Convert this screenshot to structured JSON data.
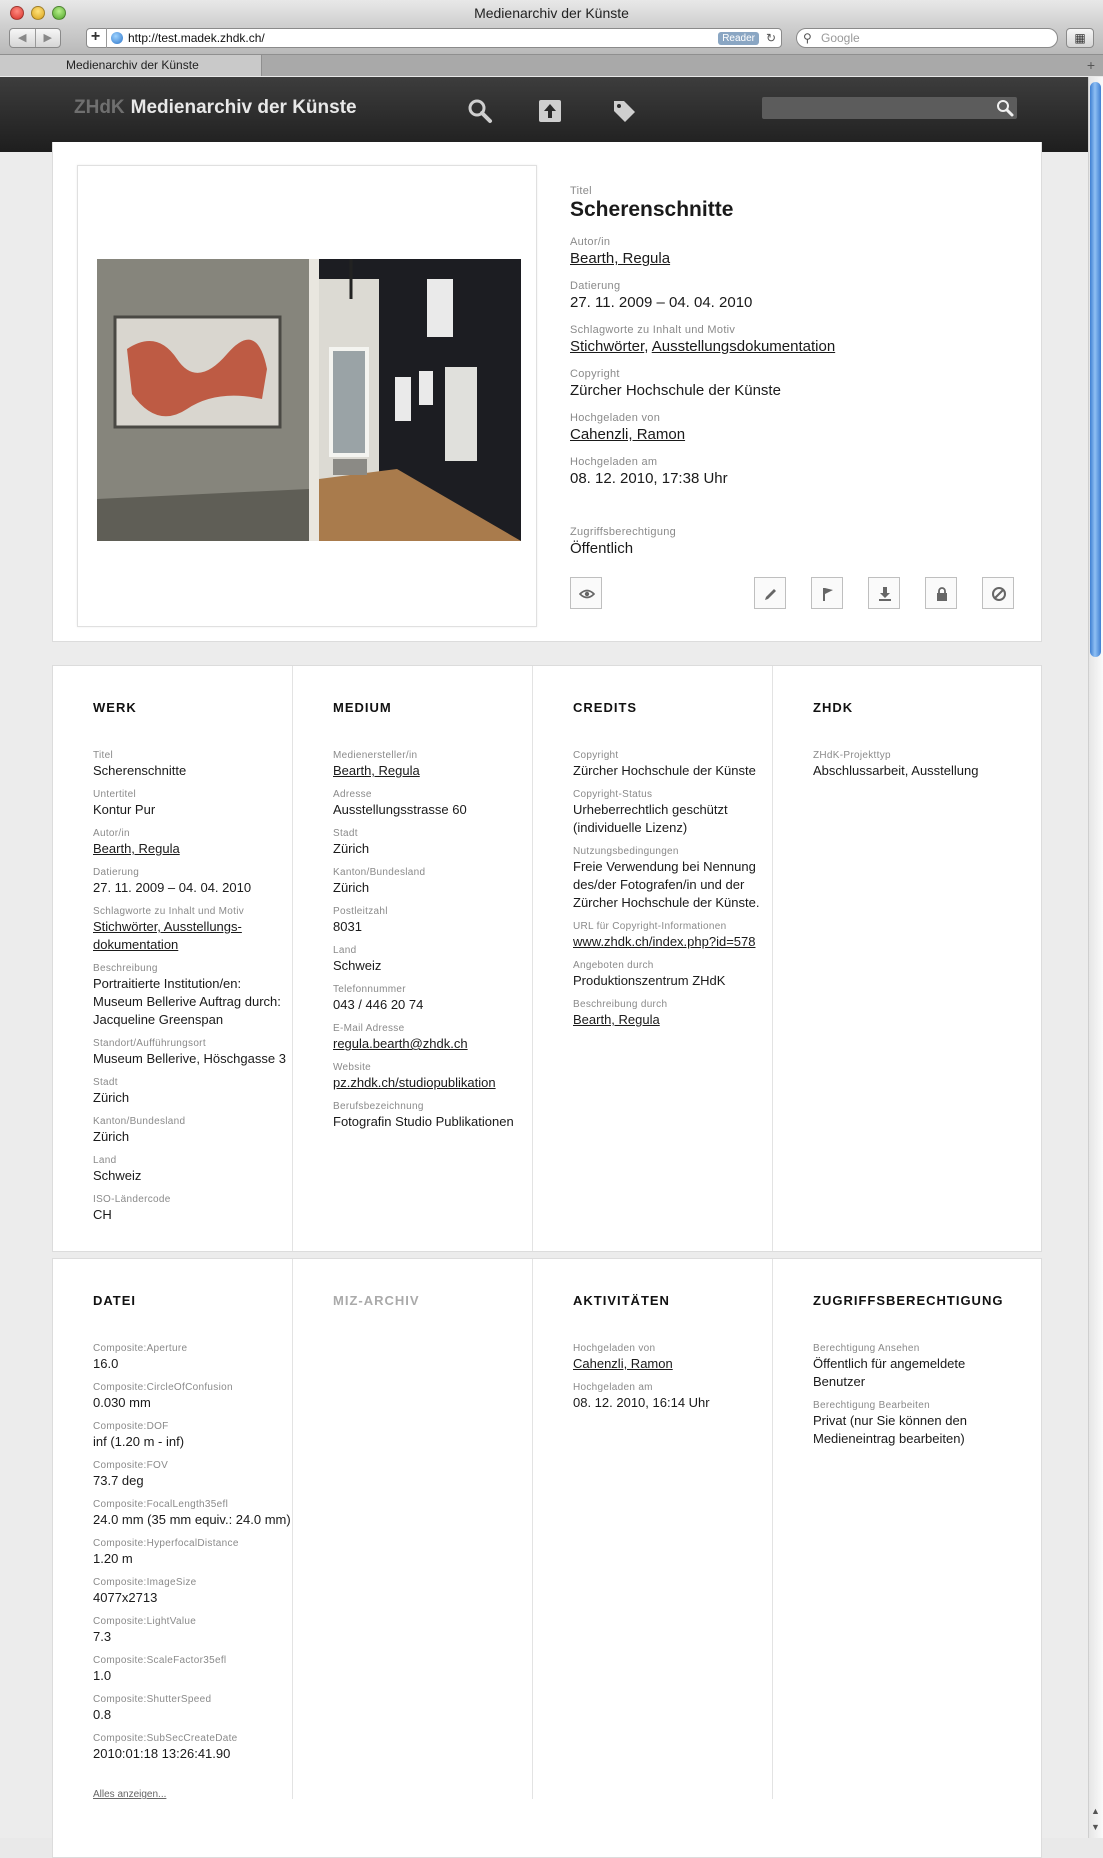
{
  "window": {
    "title": "Medienarchiv der Künste"
  },
  "browser": {
    "url": "http://test.madek.zhdk.ch/",
    "reader_label": "Reader",
    "search_placeholder": "Google",
    "tab_title": "Medienarchiv der Künste"
  },
  "header": {
    "brand_short": "ZHdK",
    "brand_name": "Medienarchiv der Künste",
    "icons": [
      "search-icon",
      "upload-icon",
      "tag-icon"
    ],
    "search_value": ""
  },
  "entry": {
    "title_label": "Titel",
    "title": "Scherenschnitte",
    "author_label": "Autor/in",
    "author": "Bearth, Regula",
    "date_label": "Datierung",
    "date": "27. 11. 2009 – 04. 04. 2010",
    "keywords_label": "Schlagworte zu Inhalt und Motiv",
    "keyword1": "Stichwörter",
    "keyword_sep": ", ",
    "keyword2": "Ausstellungsdokumentation",
    "copyright_label": "Copyright",
    "copyright": "Zürcher Hochschule der Künste",
    "uploaded_by_label": "Hochgeladen von",
    "uploaded_by": "Cahenzli, Ramon",
    "uploaded_at_label": "Hochgeladen am",
    "uploaded_at": "08. 12. 2010, 17:38 Uhr",
    "access_label": "Zugriffsberechtigung",
    "access": "Öffentlich",
    "action_icons": [
      "eye-icon",
      "pencil-icon",
      "flag-icon",
      "download-icon",
      "lock-icon",
      "block-icon"
    ]
  },
  "details": {
    "werk": {
      "heading": "WERK",
      "fields": [
        {
          "label": "Titel",
          "value": "Scherenschnitte",
          "link": false
        },
        {
          "label": "Untertitel",
          "value": "Kontur Pur",
          "link": false
        },
        {
          "label": "Autor/in",
          "value": "Bearth, Regula",
          "link": true
        },
        {
          "label": "Datierung",
          "value": "27. 11. 2009 – 04. 04. 2010",
          "link": false
        },
        {
          "label": "Schlagworte zu Inhalt und Motiv",
          "value": "Stichwörter, Ausstellungs-dokumentation",
          "link": true
        },
        {
          "label": "Beschreibung",
          "value": "Portraitierte Institution/en: Museum Bellerive Auftrag durch: Jacqueline Greenspan",
          "link": false
        },
        {
          "label": "Standort/Aufführungsort",
          "value": "Museum Bellerive, Höschgasse 3",
          "link": false
        },
        {
          "label": "Stadt",
          "value": "Zürich",
          "link": false
        },
        {
          "label": "Kanton/Bundesland",
          "value": "Zürich",
          "link": false
        },
        {
          "label": "Land",
          "value": "Schweiz",
          "link": false
        },
        {
          "label": "ISO-Ländercode",
          "value": "CH",
          "link": false
        }
      ]
    },
    "medium": {
      "heading": "MEDIUM",
      "fields": [
        {
          "label": "Medienersteller/in",
          "value": "Bearth, Regula",
          "link": true
        },
        {
          "label": "Adresse",
          "value": "Ausstellungsstrasse 60",
          "link": false
        },
        {
          "label": "Stadt",
          "value": "Zürich",
          "link": false
        },
        {
          "label": "Kanton/Bundesland",
          "value": "Zürich",
          "link": false
        },
        {
          "label": "Postleitzahl",
          "value": "8031",
          "link": false
        },
        {
          "label": "Land",
          "value": "Schweiz",
          "link": false
        },
        {
          "label": "Telefonnummer",
          "value": "043 / 446 20 74",
          "link": false
        },
        {
          "label": "E-Mail Adresse",
          "value": "regula.bearth@zhdk.ch",
          "link": true
        },
        {
          "label": "Website",
          "value": "pz.zhdk.ch/studiopublikation",
          "link": true
        },
        {
          "label": "Berufsbezeichnung",
          "value": "Fotografin Studio Publikationen",
          "link": false
        }
      ]
    },
    "credits": {
      "heading": "CREDITS",
      "fields": [
        {
          "label": "Copyright",
          "value": "Zürcher Hochschule der Künste",
          "link": false
        },
        {
          "label": "Copyright-Status",
          "value": "Urheberrechtlich geschützt (individuelle Lizenz)",
          "link": false
        },
        {
          "label": "Nutzungsbedingungen",
          "value": "Freie Verwendung bei Nennung des/der Fotografen/in und der Zürcher Hochschule der Künste.",
          "link": false
        },
        {
          "label": "URL für Copyright-Informationen",
          "value": "www.zhdk.ch/index.php?id=578",
          "link": true
        },
        {
          "label": "Angeboten durch",
          "value": "Produktionszentrum ZHdK",
          "link": false
        },
        {
          "label": "Beschreibung durch",
          "value": "Bearth, Regula",
          "link": true
        }
      ]
    },
    "zhdk": {
      "heading": "ZHDK",
      "fields": [
        {
          "label": "ZHdK-Projekttyp",
          "value": "Abschlussarbeit, Ausstellung",
          "link": false
        }
      ]
    }
  },
  "technical": {
    "datei": {
      "heading": "DATEI",
      "fields": [
        {
          "label": "Composite:Aperture",
          "value": "16.0",
          "link": false
        },
        {
          "label": "Composite:CircleOfConfusion",
          "value": "0.030 mm",
          "link": false
        },
        {
          "label": "Composite:DOF",
          "value": "inf (1.20 m - inf)",
          "link": false
        },
        {
          "label": "Composite:FOV",
          "value": "73.7 deg",
          "link": false
        },
        {
          "label": "Composite:FocalLength35efl",
          "value": "24.0 mm (35 mm equiv.: 24.0 mm)",
          "link": false
        },
        {
          "label": "Composite:HyperfocalDistance",
          "value": "1.20 m",
          "link": false
        },
        {
          "label": "Composite:ImageSize",
          "value": "4077x2713",
          "link": false
        },
        {
          "label": "Composite:LightValue",
          "value": "7.3",
          "link": false
        },
        {
          "label": "Composite:ScaleFactor35efl",
          "value": "1.0",
          "link": false
        },
        {
          "label": "Composite:ShutterSpeed",
          "value": "0.8",
          "link": false
        },
        {
          "label": "Composite:SubSecCreateDate",
          "value": "2010:01:18 13:26:41.90",
          "link": false
        }
      ],
      "show_all": "Alles anzeigen..."
    },
    "miz": {
      "heading": "MIZ-ARCHIV",
      "fields": []
    },
    "aktivitaeten": {
      "heading": "AKTIVITÄTEN",
      "fields": [
        {
          "label": "Hochgeladen von",
          "value": "Cahenzli, Ramon",
          "link": true
        },
        {
          "label": "Hochgeladen am",
          "value": "08. 12. 2010, 16:14 Uhr",
          "link": false
        }
      ]
    },
    "zugriff": {
      "heading": "ZUGRIFFSBERECHTIGUNG",
      "fields": [
        {
          "label": "Berechtigung Ansehen",
          "value": "Öffentlich für angemeldete Benutzer",
          "link": false
        },
        {
          "label": "Berechtigung Bearbeiten",
          "value": "Privat (nur Sie können den Medieneintrag bearbeiten)",
          "link": false
        }
      ]
    }
  },
  "colors": {
    "header_bg": "#2a2a2a",
    "scroll_thumb": "#5b9be6",
    "page_bg": "#ececec"
  }
}
